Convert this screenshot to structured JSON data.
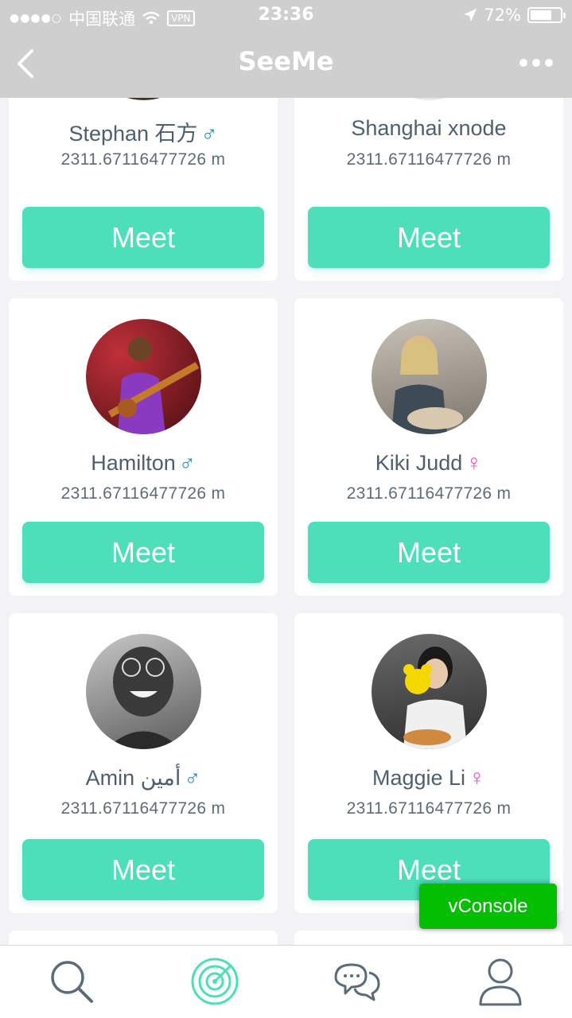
{
  "status_bar": {
    "carrier": "中国联通",
    "vpn": "VPN",
    "time": "23:36",
    "battery": "72%",
    "battery_level": 0.72
  },
  "nav": {
    "title": "SeeMe"
  },
  "users": [
    {
      "name": "Stephan 石方",
      "gender": "♂",
      "distance": "2311.67116477726 m",
      "button": "Meet"
    },
    {
      "name": "Shanghai xnode",
      "gender": "",
      "distance": "2311.67116477726 m",
      "button": "Meet"
    },
    {
      "name": "Hamilton",
      "gender": "♂",
      "distance": "2311.67116477726 m",
      "button": "Meet"
    },
    {
      "name": "Kiki Judd",
      "gender": "♀",
      "distance": "2311.67116477726 m",
      "button": "Meet"
    },
    {
      "name": "Amin أمين",
      "gender": "♂",
      "distance": "2311.67116477726 m",
      "button": "Meet"
    },
    {
      "name": "Maggie Li",
      "gender": "♀",
      "distance": "2311.67116477726 m",
      "button": "Meet"
    }
  ],
  "tabs": [
    {
      "icon": "search-icon"
    },
    {
      "icon": "radar-icon",
      "active": true
    },
    {
      "icon": "chat-icon"
    },
    {
      "icon": "profile-icon"
    }
  ],
  "colors": {
    "accent": "#4ddfba",
    "male": "#1e88d0",
    "female": "#e84fc3",
    "vconsole": "#04be02"
  },
  "vconsole": {
    "label": "vConsole"
  }
}
